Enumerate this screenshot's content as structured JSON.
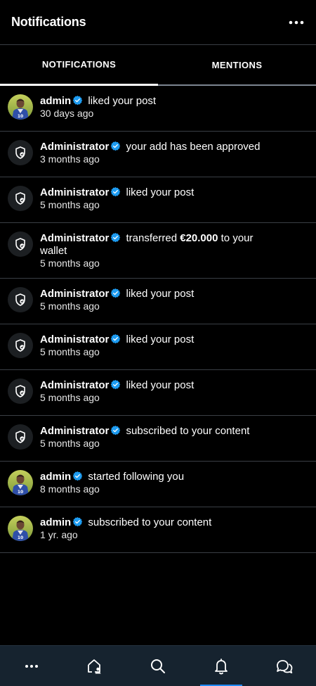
{
  "header": {
    "title": "Notifications",
    "more_icon": "more-horizontal-icon"
  },
  "tabs": [
    {
      "label": "NOTIFICATIONS",
      "active": true
    },
    {
      "label": "MENTIONS",
      "active": false
    }
  ],
  "colors": {
    "accent": "#1f8bff",
    "background": "#000000",
    "nav_background": "#16232f",
    "verified": "#1d9bf0"
  },
  "notifications": [
    {
      "name": "admin",
      "avatar": "photo",
      "prefix": "liked your post",
      "time": "30 days ago"
    },
    {
      "name": "Administrator",
      "avatar": "shield-icon",
      "prefix": "your add has been approved",
      "time": "3 months ago"
    },
    {
      "name": "Administrator",
      "avatar": "shield-icon",
      "prefix": "liked your post",
      "time": "5 months ago"
    },
    {
      "name": "Administrator",
      "avatar": "shield-icon",
      "prefix": "transferred",
      "amount": "€20.000",
      "suffix": "to your",
      "line2": "wallet",
      "time": "5 months ago"
    },
    {
      "name": "Administrator",
      "avatar": "shield-icon",
      "prefix": "liked your post",
      "time": "5 months ago"
    },
    {
      "name": "Administrator",
      "avatar": "shield-icon",
      "prefix": "liked your post",
      "time": "5 months ago"
    },
    {
      "name": "Administrator",
      "avatar": "shield-icon",
      "prefix": "liked your post",
      "time": "5 months ago"
    },
    {
      "name": "Administrator",
      "avatar": "shield-icon",
      "prefix": "subscribed to your content",
      "time": "5 months ago"
    },
    {
      "name": "admin",
      "avatar": "photo",
      "prefix": "started following you",
      "time": "8 months ago"
    },
    {
      "name": "admin",
      "avatar": "photo",
      "prefix": "subscribed to your content",
      "time": "1 yr. ago"
    }
  ],
  "bottom_nav": [
    {
      "icon": "more-horizontal-icon",
      "active": false
    },
    {
      "icon": "home-user-icon",
      "active": false
    },
    {
      "icon": "search-icon",
      "active": false
    },
    {
      "icon": "bell-icon",
      "active": true
    },
    {
      "icon": "chat-bubbles-icon",
      "active": false
    }
  ]
}
